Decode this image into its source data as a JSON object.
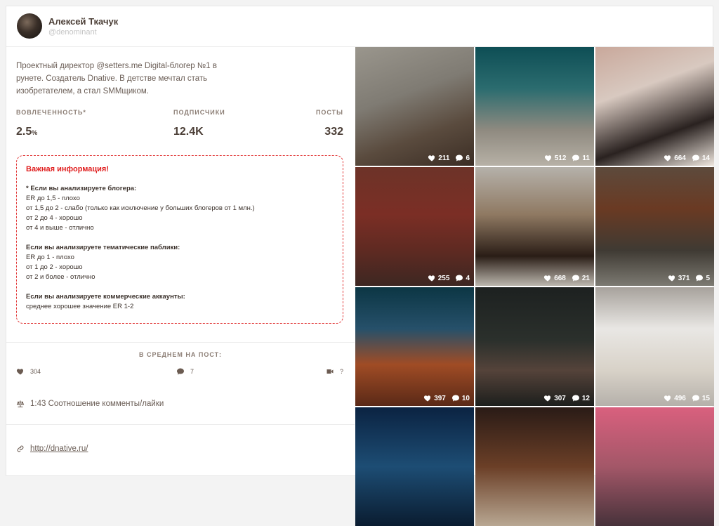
{
  "profile": {
    "name": "Алексей Ткачук",
    "handle": "@denominant",
    "bio": "Проектный директор @setters.me Digital-блогер №1 в рунете. Создатель Dnative. В детстве мечтал стать изобретателем, а стал SMMщиком."
  },
  "stats": {
    "engagement_label": "ВОВЛЕЧЕННОСТЬ*",
    "engagement_value": "2.5",
    "engagement_unit": "%",
    "followers_label": "ПОДПИСЧИКИ",
    "followers_value": "12.4K",
    "posts_label": "ПОСТЫ",
    "posts_value": "332"
  },
  "notice": {
    "title": "Важная информация!",
    "blogger_heading": "* Если вы анализируете блогера:",
    "blogger_lines": [
      "ER до 1,5 - плохо",
      "от 1,5 до 2 - слабо (только как исключение у больших блогеров от 1 млн.)",
      "от 2 до 4 - хорошо",
      "от 4 и выше - отлично"
    ],
    "public_heading": "Если вы анализируете тематические паблики:",
    "public_lines": [
      "ER до 1 - плохо",
      "от 1 до 2 - хорошо",
      "от 2 и более - отлично"
    ],
    "commercial_heading": "Если вы анализируете коммерческие аккаунты:",
    "commercial_lines": [
      "среднее хорошее значение ER 1-2"
    ]
  },
  "average": {
    "title": "В СРЕДНЕМ НА ПОСТ:",
    "likes": "304",
    "comments": "7",
    "video": "?"
  },
  "ratio": "1:43 Соотношение комменты/лайки",
  "link": "http://dnative.ru/",
  "posts": [
    {
      "likes": "211",
      "comments": "6"
    },
    {
      "likes": "512",
      "comments": "11"
    },
    {
      "likes": "664",
      "comments": "14"
    },
    {
      "likes": "255",
      "comments": "4"
    },
    {
      "likes": "668",
      "comments": "21"
    },
    {
      "likes": "371",
      "comments": "5"
    },
    {
      "likes": "397",
      "comments": "10"
    },
    {
      "likes": "307",
      "comments": "12"
    },
    {
      "likes": "496",
      "comments": "15"
    }
  ],
  "colors": {
    "accent_red": "#e01f1f",
    "text": "#5b4d44"
  }
}
